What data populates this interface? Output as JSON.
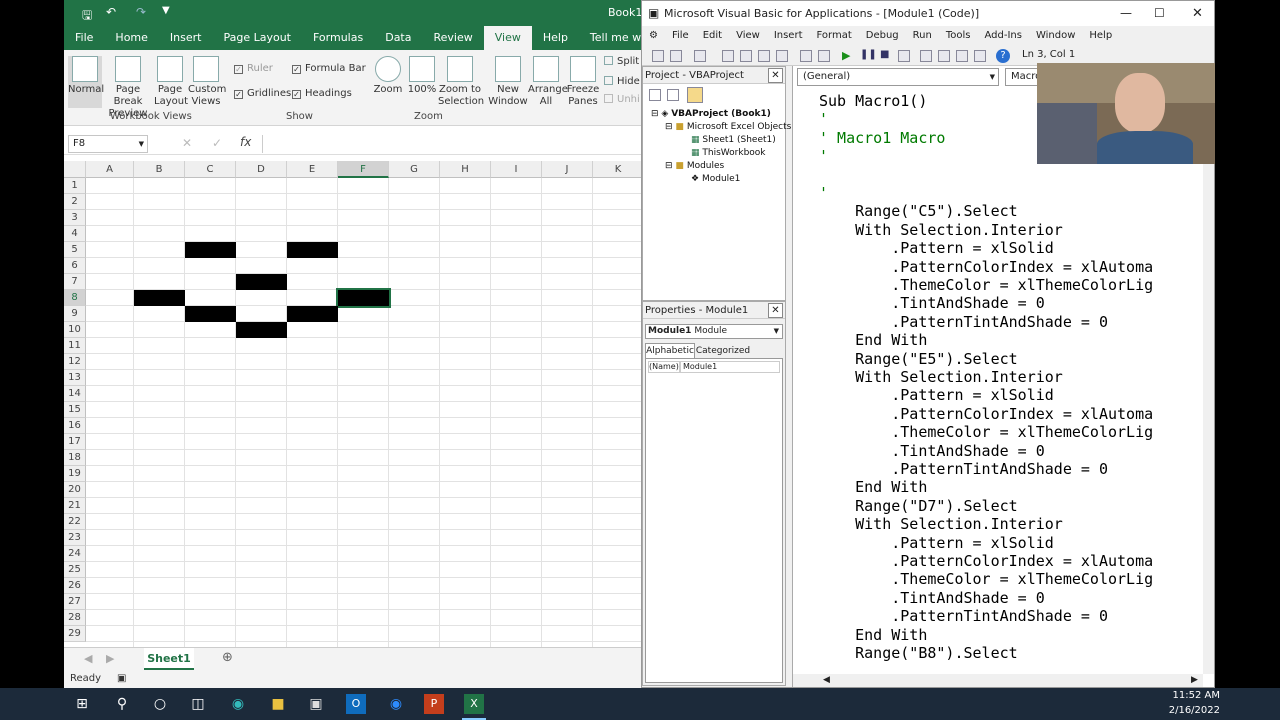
{
  "excel": {
    "title": "Book1",
    "qat": [
      "save-icon",
      "undo-icon",
      "redo-icon",
      "customize-icon"
    ],
    "tabs": [
      "File",
      "Home",
      "Insert",
      "Page Layout",
      "Formulas",
      "Data",
      "Review",
      "View",
      "Help"
    ],
    "active_tab": "View",
    "tell_me": "Tell me what you want t",
    "ribbon": {
      "workbook_views": [
        "Normal",
        "Page Break Preview",
        "Page Layout",
        "Custom Views"
      ],
      "workbook_views_label": "Workbook Views",
      "show": {
        "ruler": "Ruler",
        "formula_bar": "Formula Bar",
        "gridlines": "Gridlines",
        "headings": "Headings"
      },
      "show_label": "Show",
      "zoom": [
        "Zoom",
        "100%",
        "Zoom to Selection"
      ],
      "zoom_label": "Zoom",
      "window": [
        "New Window",
        "Arrange All",
        "Freeze Panes"
      ],
      "split": "Split",
      "hide": "Hide",
      "unhide": "Unhi"
    },
    "name_box": "F8",
    "columns": [
      "A",
      "B",
      "C",
      "D",
      "E",
      "F",
      "G",
      "H",
      "I",
      "J",
      "K"
    ],
    "rows": [
      "1",
      "2",
      "3",
      "4",
      "5",
      "6",
      "7",
      "8",
      "9",
      "10",
      "11",
      "12",
      "13",
      "14",
      "15",
      "16",
      "17",
      "18",
      "19",
      "20",
      "21",
      "22",
      "23",
      "24",
      "25",
      "26",
      "27",
      "28",
      "29"
    ],
    "filled_cells": [
      "C5",
      "E5",
      "D7",
      "B8",
      "F8",
      "C9",
      "E9",
      "D10"
    ],
    "selected_cell": "F8",
    "sheet_tab": "Sheet1",
    "status": "Ready"
  },
  "vba": {
    "title": "Microsoft Visual Basic for Applications - [Module1 (Code)]",
    "menu": [
      "File",
      "Edit",
      "View",
      "Insert",
      "Format",
      "Debug",
      "Run",
      "Tools",
      "Add-Ins",
      "Window",
      "Help"
    ],
    "position": "Ln 3, Col 1",
    "project_title": "Project - VBAProject",
    "tree": {
      "root": "VBAProject (Book1)",
      "excel_objects": "Microsoft Excel Objects",
      "sheet1": "Sheet1 (Sheet1)",
      "thisworkbook": "ThisWorkbook",
      "modules": "Modules",
      "module1": "Module1"
    },
    "properties_title": "Properties - Module1",
    "properties_object": "Module1",
    "properties_type": "Module",
    "prop_tabs": [
      "Alphabetic",
      "Categorized"
    ],
    "prop_name_key": "(Name)",
    "prop_name_value": "Module1",
    "general_combo": "(General)",
    "proc_combo": "Macro",
    "code": [
      "Sub Macro1()",
      "'",
      "' Macro1 Macro",
      "'",
      "",
      "'",
      "    Range(\"C5\").Select",
      "    With Selection.Interior",
      "        .Pattern = xlSolid",
      "        .PatternColorIndex = xlAutoma",
      "        .ThemeColor = xlThemeColorLig",
      "        .TintAndShade = 0",
      "        .PatternTintAndShade = 0",
      "    End With",
      "    Range(\"E5\").Select",
      "    With Selection.Interior",
      "        .Pattern = xlSolid",
      "        .PatternColorIndex = xlAutoma",
      "        .ThemeColor = xlThemeColorLig",
      "        .TintAndShade = 0",
      "        .PatternTintAndShade = 0",
      "    End With",
      "    Range(\"D7\").Select",
      "    With Selection.Interior",
      "        .Pattern = xlSolid",
      "        .PatternColorIndex = xlAutoma",
      "        .ThemeColor = xlThemeColorLig",
      "        .TintAndShade = 0",
      "        .PatternTintAndShade = 0",
      "    End With",
      "    Range(\"B8\").Select"
    ]
  },
  "taskbar": {
    "time": "11:52 AM",
    "date": "2/16/2022",
    "apps": [
      "start-icon",
      "search-icon",
      "cortana-icon",
      "task-view-icon",
      "edge-icon",
      "file-explorer-icon",
      "store-icon",
      "outlook-icon",
      "zoom-icon",
      "powerpoint-icon",
      "excel-icon"
    ]
  },
  "colors": {
    "excel_green": "#217346",
    "cell_fill": "#000000",
    "comment": "#007a00"
  }
}
